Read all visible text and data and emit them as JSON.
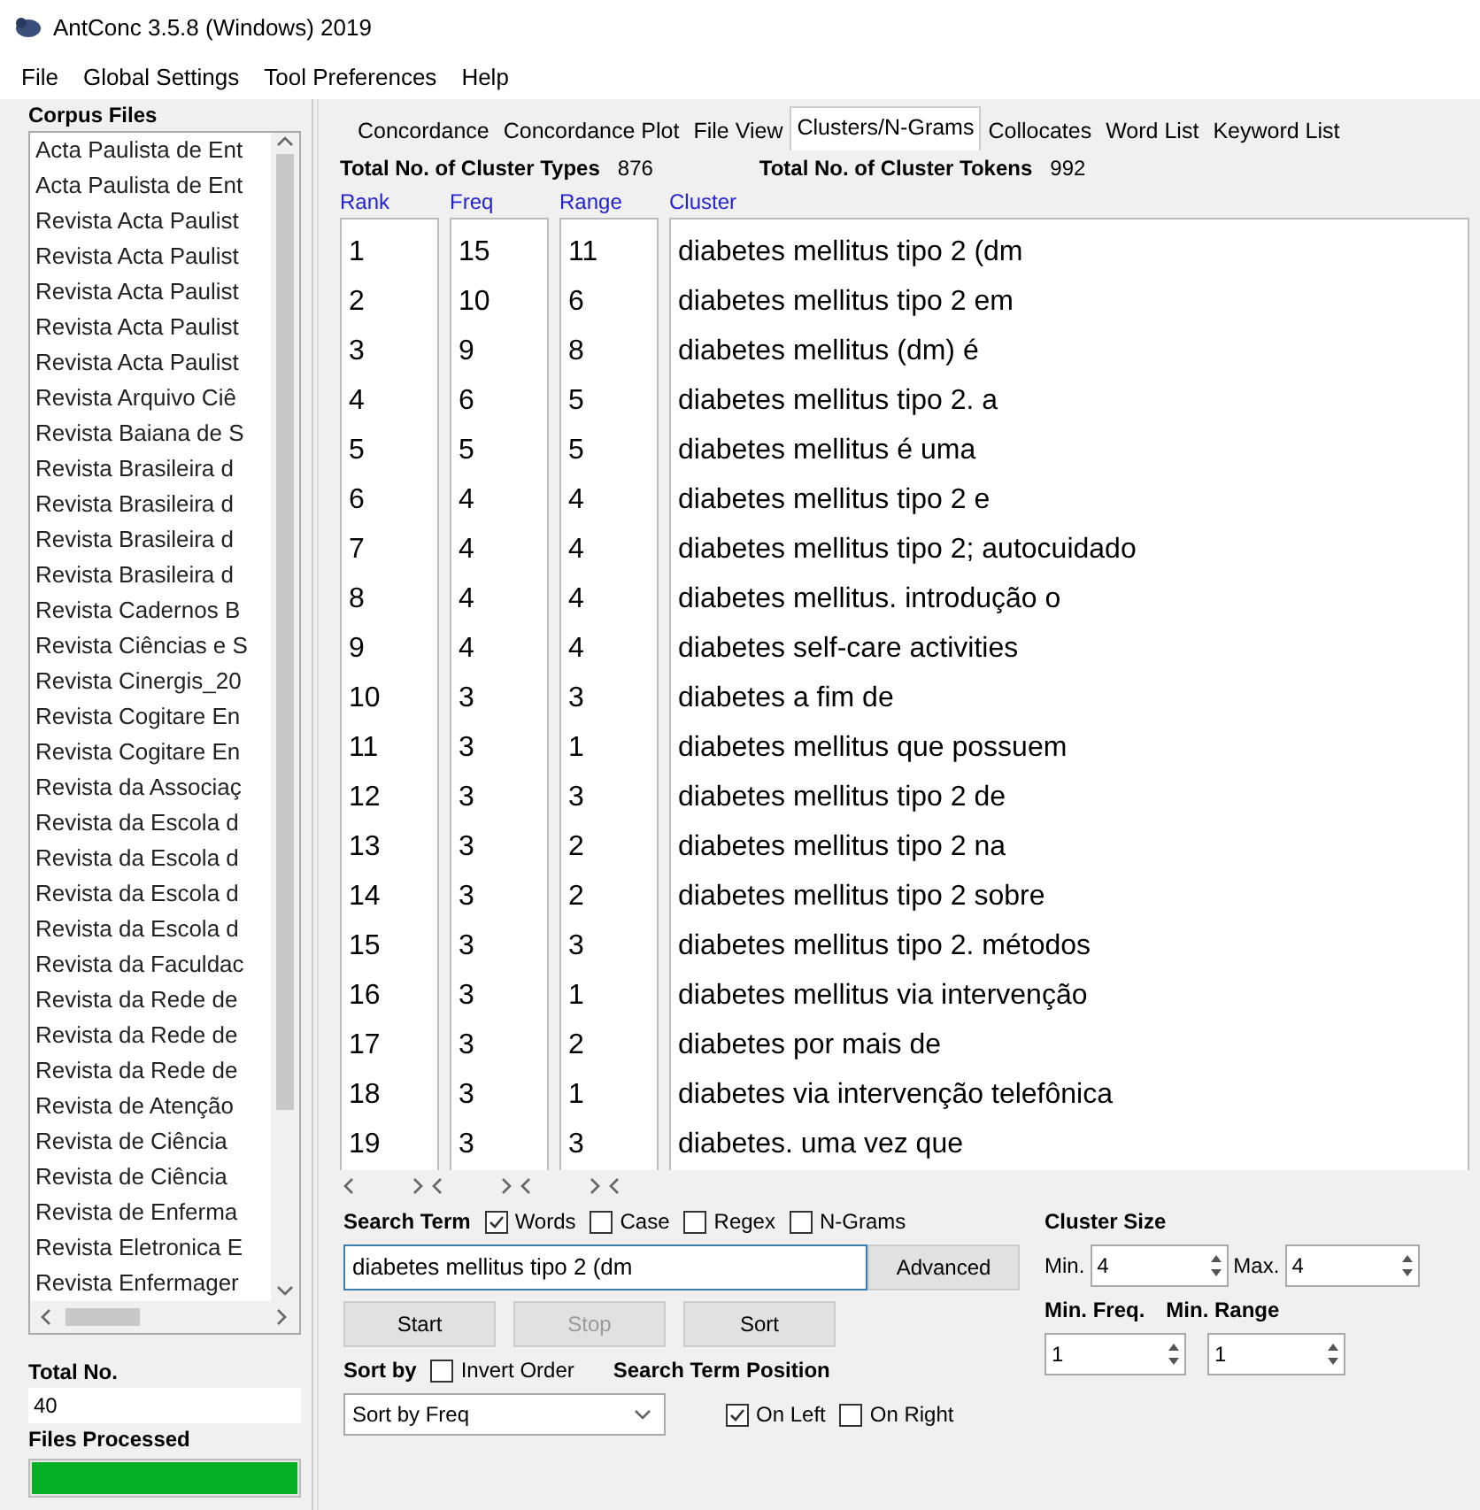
{
  "window": {
    "title": "AntConc 3.5.8 (Windows) 2019"
  },
  "menu": [
    "File",
    "Global Settings",
    "Tool Preferences",
    "Help"
  ],
  "corpus": {
    "title": "Corpus Files",
    "files": [
      "Acta Paulista de Ent",
      "Acta Paulista de Ent",
      "Revista Acta Paulist",
      "Revista Acta Paulist",
      "Revista Acta Paulist",
      "Revista Acta Paulist",
      "Revista Acta Paulist",
      "Revista Arquivo Ciê",
      "Revista Baiana de S",
      "Revista Brasileira d",
      "Revista Brasileira d",
      "Revista Brasileira d",
      "Revista Brasileira d",
      "Revista Cadernos B",
      "Revista Ciências e S",
      "Revista Cinergis_20",
      "Revista Cogitare En",
      "Revista Cogitare En",
      "Revista da Associaç",
      "Revista da Escola d",
      "Revista da Escola d",
      "Revista da Escola d",
      "Revista da Escola d",
      "Revista da Faculdac",
      "Revista da Rede de",
      "Revista da Rede de",
      "Revista da Rede de",
      "Revista de Atenção",
      "Revista de Ciência",
      "Revista de Ciência",
      "Revista de Enferma",
      "Revista Eletronica E",
      "Revista Enfermager"
    ],
    "total_label": "Total No.",
    "total_value": "40",
    "processed_label": "Files Processed",
    "progress": {
      "level": 1
    }
  },
  "tabs": [
    {
      "label": "Concordance",
      "selected": false
    },
    {
      "label": "Concordance Plot",
      "selected": false
    },
    {
      "label": "File View",
      "selected": false
    },
    {
      "label": "Clusters/N-Grams",
      "selected": true
    },
    {
      "label": "Collocates",
      "selected": false
    },
    {
      "label": "Word List",
      "selected": false
    },
    {
      "label": "Keyword List",
      "selected": false
    }
  ],
  "totals": [
    {
      "label": "Total No. of Cluster Types",
      "value": "876"
    },
    {
      "label": "Total No. of Cluster Tokens",
      "value": "992"
    }
  ],
  "table": {
    "columns": [
      "Rank",
      "Freq",
      "Range",
      "Cluster"
    ],
    "rows": [
      [
        "1",
        "15",
        "11",
        "diabetes mellitus tipo 2 (dm"
      ],
      [
        "2",
        "10",
        "6",
        "diabetes mellitus tipo 2 em"
      ],
      [
        "3",
        "9",
        "8",
        "diabetes mellitus (dm) é"
      ],
      [
        "4",
        "6",
        "5",
        "diabetes mellitus tipo 2. a"
      ],
      [
        "5",
        "5",
        "5",
        "diabetes mellitus é uma"
      ],
      [
        "6",
        "4",
        "4",
        "diabetes mellitus tipo 2 e"
      ],
      [
        "7",
        "4",
        "4",
        "diabetes mellitus tipo 2; autocuidado"
      ],
      [
        "8",
        "4",
        "4",
        "diabetes mellitus.  introdução o"
      ],
      [
        "9",
        "4",
        "4",
        "diabetes self-care activities"
      ],
      [
        "10",
        "3",
        "3",
        "diabetes a fim de"
      ],
      [
        "11",
        "3",
        "1",
        "diabetes mellitus que possuem"
      ],
      [
        "12",
        "3",
        "3",
        "diabetes mellitus tipo 2 de"
      ],
      [
        "13",
        "3",
        "2",
        "diabetes mellitus tipo 2 na"
      ],
      [
        "14",
        "3",
        "2",
        "diabetes mellitus tipo 2 sobre"
      ],
      [
        "15",
        "3",
        "3",
        "diabetes mellitus tipo 2. métodos"
      ],
      [
        "16",
        "3",
        "1",
        "diabetes mellitus via intervenção"
      ],
      [
        "17",
        "3",
        "2",
        "diabetes por mais de"
      ],
      [
        "18",
        "3",
        "1",
        "diabetes via intervenção telefônica"
      ],
      [
        "19",
        "3",
        "3",
        "diabetes. uma vez que"
      ]
    ]
  },
  "search": {
    "label": "Search Term",
    "options": [
      {
        "label": "Words",
        "checked": true
      },
      {
        "label": "Case",
        "checked": false
      },
      {
        "label": "Regex",
        "checked": false
      },
      {
        "label": "N-Grams",
        "checked": false
      }
    ],
    "value": "diabetes mellitus tipo 2 (dm",
    "advanced": "Advanced"
  },
  "buttons": [
    {
      "label": "Start",
      "disabled": false
    },
    {
      "label": "Stop",
      "disabled": true
    },
    {
      "label": "Sort",
      "disabled": false
    }
  ],
  "sort": {
    "label": "Sort by",
    "invert": {
      "label": "Invert Order",
      "checked": false
    },
    "value": "Sort by Freq"
  },
  "position": {
    "label": "Search Term Position",
    "options": [
      {
        "label": "On Left",
        "checked": true
      },
      {
        "label": "On Right",
        "checked": false
      }
    ]
  },
  "cluster_size": {
    "label": "Cluster Size",
    "min_label": "Min.",
    "min": "4",
    "max_label": "Max.",
    "max": "4"
  },
  "min_freq": {
    "label": "Min. Freq.",
    "value": "1"
  },
  "min_range": {
    "label": "Min. Range",
    "value": "1"
  }
}
